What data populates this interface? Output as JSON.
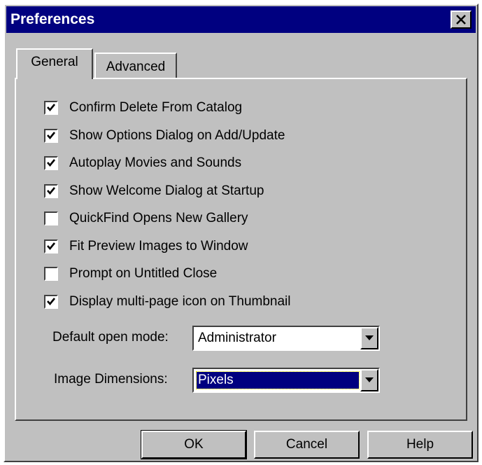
{
  "window": {
    "title": "Preferences"
  },
  "tabs": [
    {
      "label": "General",
      "active": true
    },
    {
      "label": "Advanced",
      "active": false
    }
  ],
  "options": [
    {
      "label": "Confirm Delete From Catalog",
      "checked": true
    },
    {
      "label": "Show Options Dialog on Add/Update",
      "checked": true
    },
    {
      "label": "Autoplay Movies and Sounds",
      "checked": true
    },
    {
      "label": "Show Welcome Dialog at Startup",
      "checked": true
    },
    {
      "label": "QuickFind Opens New Gallery",
      "checked": false
    },
    {
      "label": "Fit Preview Images to Window",
      "checked": true
    },
    {
      "label": "Prompt on Untitled Close",
      "checked": false
    },
    {
      "label": "Display multi-page icon on Thumbnail",
      "checked": true
    }
  ],
  "fields": {
    "open_mode": {
      "label": "Default open mode:",
      "value": "Administrator"
    },
    "image_dimensions": {
      "label": "Image Dimensions:",
      "value": "Pixels"
    }
  },
  "buttons": {
    "ok": "OK",
    "cancel": "Cancel",
    "help": "Help"
  },
  "colors": {
    "titlebar": "#000080",
    "face": "#c0c0c0",
    "highlight": "#000080"
  }
}
